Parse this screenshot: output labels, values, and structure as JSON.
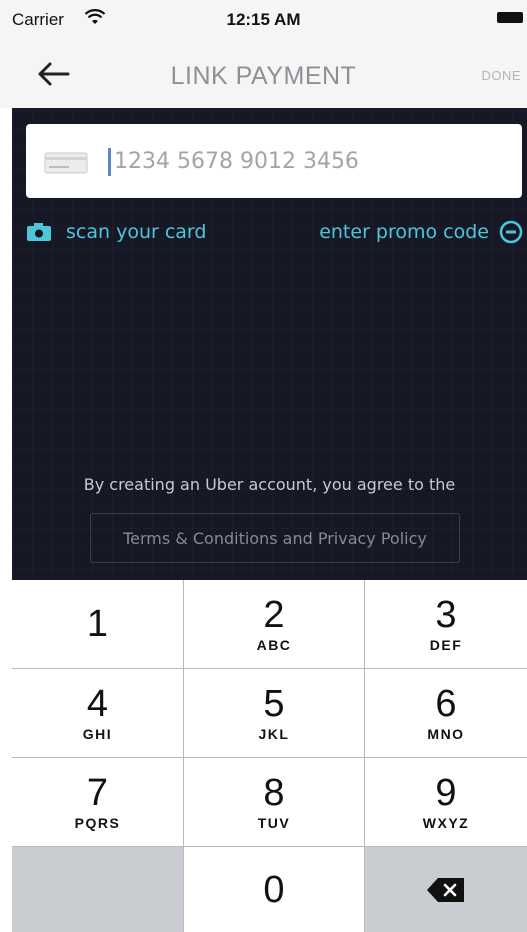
{
  "status_bar": {
    "carrier": "Carrier",
    "time": "12:15 AM"
  },
  "nav": {
    "title": "LINK PAYMENT",
    "done_label": "DONE",
    "back_icon": "arrow-left-icon"
  },
  "card_field": {
    "placeholder": "1234 5678 9012 3456",
    "value": "",
    "icon": "credit-card-icon"
  },
  "scan": {
    "label": "scan your card",
    "icon": "camera-icon"
  },
  "promo": {
    "label": "enter promo code",
    "icon": "minus-circle-icon"
  },
  "legal": {
    "agree_text": "By creating an Uber account, you agree to the",
    "terms_label": "Terms & Conditions and Privacy Policy"
  },
  "keypad": {
    "keys": [
      {
        "digit": "1",
        "letters": ""
      },
      {
        "digit": "2",
        "letters": "ABC"
      },
      {
        "digit": "3",
        "letters": "DEF"
      },
      {
        "digit": "4",
        "letters": "GHI"
      },
      {
        "digit": "5",
        "letters": "JKL"
      },
      {
        "digit": "6",
        "letters": "MNO"
      },
      {
        "digit": "7",
        "letters": "PQRS"
      },
      {
        "digit": "8",
        "letters": "TUV"
      },
      {
        "digit": "9",
        "letters": "WXYZ"
      },
      {
        "digit": "0",
        "letters": ""
      }
    ],
    "delete_icon": "backspace-icon"
  },
  "colors": {
    "accent": "#4fc6d8",
    "background": "#161825",
    "caret": "#5a86c4"
  }
}
